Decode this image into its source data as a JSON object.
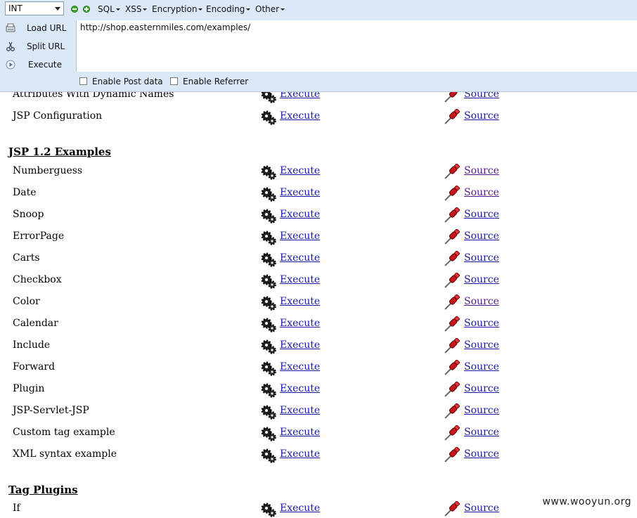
{
  "hackbar": {
    "select_value": "INT",
    "menus": [
      "SQL",
      "XSS",
      "Encryption",
      "Encoding",
      "Other"
    ],
    "load_url_label": "Load URL",
    "split_url_label": "Split URL",
    "execute_label": "Execute",
    "url_value": "http://shop.easternmiles.com/examples/",
    "enable_post_label": "Enable Post data",
    "enable_referrer_label": "Enable Referrer"
  },
  "content": {
    "top_rows": [
      {
        "name": "Attributes With Dynamic Names",
        "execute": "Execute",
        "source": "Source"
      },
      {
        "name": "JSP Configuration",
        "execute": "Execute",
        "source": "Source"
      }
    ],
    "section1_title": "JSP 1.2 Examples",
    "section1_rows": [
      {
        "name": "Numberguess",
        "execute": "Execute",
        "source": "Source"
      },
      {
        "name": "Date",
        "execute": "Execute",
        "source": "Source"
      },
      {
        "name": "Snoop",
        "execute": "Execute",
        "source": "Source"
      },
      {
        "name": "ErrorPage",
        "execute": "Execute",
        "source": "Source"
      },
      {
        "name": "Carts",
        "execute": "Execute",
        "source": "Source"
      },
      {
        "name": "Checkbox",
        "execute": "Execute",
        "source": "Source"
      },
      {
        "name": "Color",
        "execute": "Execute",
        "source": "Source"
      },
      {
        "name": "Calendar",
        "execute": "Execute",
        "source": "Source"
      },
      {
        "name": "Include",
        "execute": "Execute",
        "source": "Source"
      },
      {
        "name": "Forward",
        "execute": "Execute",
        "source": "Source"
      },
      {
        "name": "Plugin",
        "execute": "Execute",
        "source": "Source"
      },
      {
        "name": "JSP-Servlet-JSP",
        "execute": "Execute",
        "source": "Source"
      },
      {
        "name": "Custom tag example",
        "execute": "Execute",
        "source": "Source"
      },
      {
        "name": "XML syntax example",
        "execute": "Execute",
        "source": "Source"
      }
    ],
    "section2_title": "Tag Plugins",
    "section2_rows": [
      {
        "name": "If",
        "execute": "Execute",
        "source": "Source"
      }
    ]
  },
  "watermark": "www.wooyun.org",
  "colors": {
    "toolbar_bg": "#dbe8f6",
    "link": "#1a1aa6",
    "visited_link": "#551a8b",
    "accent_green": "#3cab2b"
  },
  "icons": {
    "execute": "gears-icon",
    "source": "red-pushpin-icon",
    "load_url": "load-url-icon",
    "split_url": "split-scissors-icon",
    "execute_btn": "play-circle-icon"
  }
}
